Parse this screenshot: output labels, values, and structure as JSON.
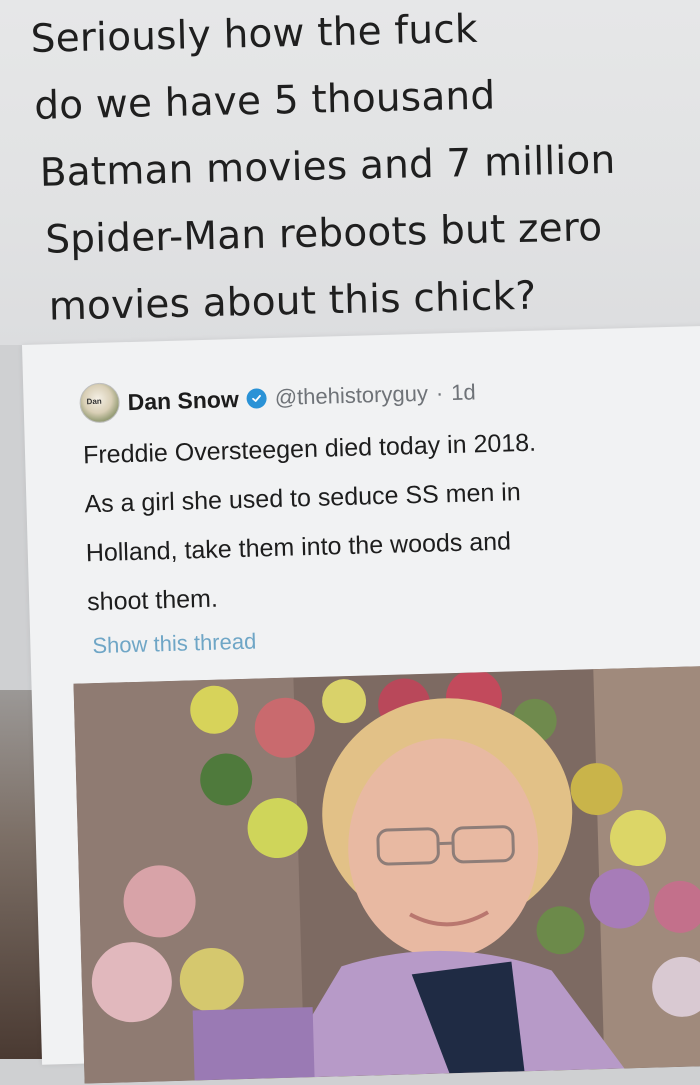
{
  "caption": {
    "lines": [
      "Seriously how the fuck",
      "do we have 5 thousand",
      "Batman movies and 7 million",
      "Spider-Man reboots but zero",
      "movies about this chick?"
    ]
  },
  "tweet": {
    "avatar_label": "Dan",
    "display_name": "Dan Snow",
    "verified_icon": "verified-badge-icon",
    "handle": "@thehistoryguy",
    "separator": "·",
    "timestamp": "1d",
    "body_lines": [
      "Freddie Oversteegen died today in 2018.",
      "As a girl she used to seduce SS men in",
      "Holland, take them into the woods and",
      "shoot them."
    ],
    "show_thread": "Show this thread"
  },
  "colors": {
    "verified": "#2a92d6",
    "link": "#6fa6c6",
    "text": "#1d1d1d",
    "muted": "#6f7378"
  }
}
